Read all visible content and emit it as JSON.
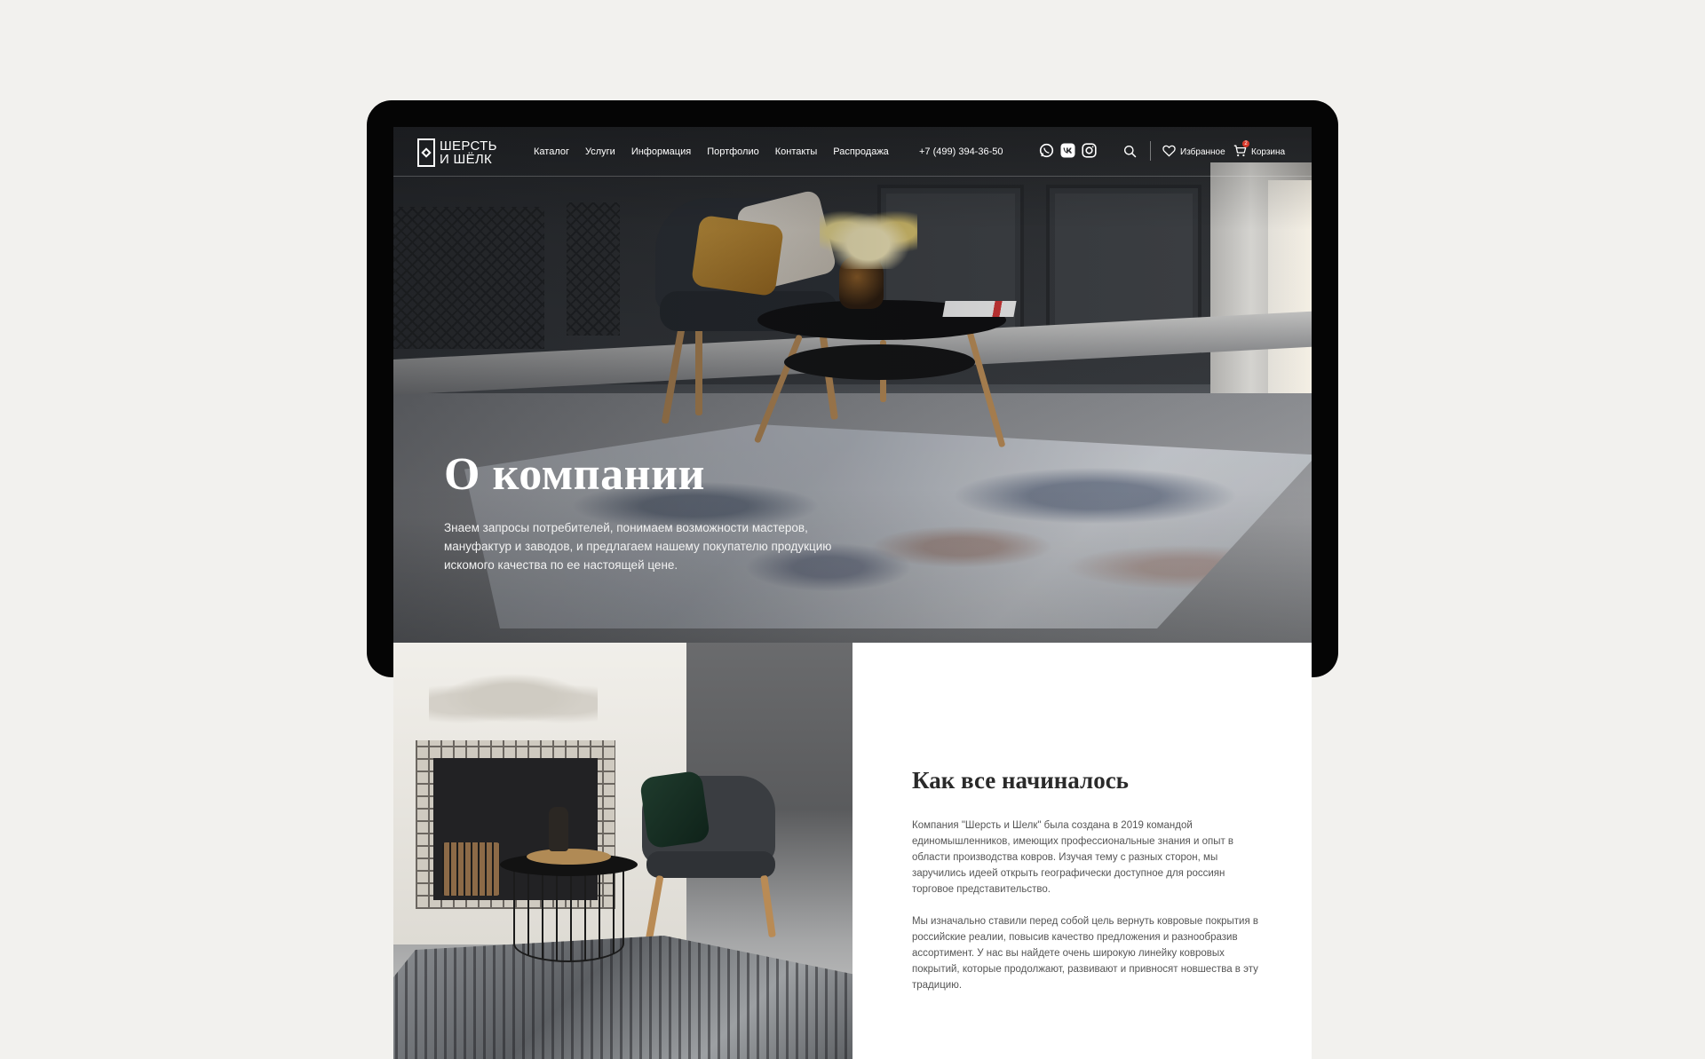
{
  "brand": {
    "logo_line1": "ШЕРСТЬ",
    "logo_line2": "И ШЁЛК"
  },
  "nav": [
    "Каталог",
    "Услуги",
    "Информация",
    "Портфолио",
    "Контакты",
    "Распродажа"
  ],
  "header": {
    "phone": "+7 (499) 394-36-50",
    "favorites_label": "Избранное",
    "cart_label": "Корзина",
    "cart_count": "2",
    "icons": [
      "whatsapp-icon",
      "vk-icon",
      "instagram-icon",
      "search-icon",
      "heart-icon",
      "cart-icon"
    ]
  },
  "hero": {
    "title": "О компании",
    "description": "Знаем запросы потребителей, понимаем возможности мастеров, мануфактур и заводов, и предлагаем нашему покупателю продукцию искомого качества по ее настоящей цене."
  },
  "about": {
    "title": "Как все начиналось",
    "paragraph1": "Компания \"Шерсть и Шелк\" была создана в 2019 командой единомышленников, имеющих профессиональные знания и опыт в области производства ковров. Изучая тему с разных сторон, мы заручились идеей открыть географически доступное для россиян торговое представительство.",
    "paragraph2": "Мы изначально ставили перед собой цель вернуть ковровые покрытия в российские реалии, повысив качество предложения и разнообразив ассортимент. У нас вы найдете очень широкую линейку ковровых покрытий, которые продолжают, развивают и привносят новшества в эту традицию."
  },
  "colors": {
    "background": "#f2f1ee",
    "device": "#050505",
    "accent_badge": "#d9392b"
  }
}
